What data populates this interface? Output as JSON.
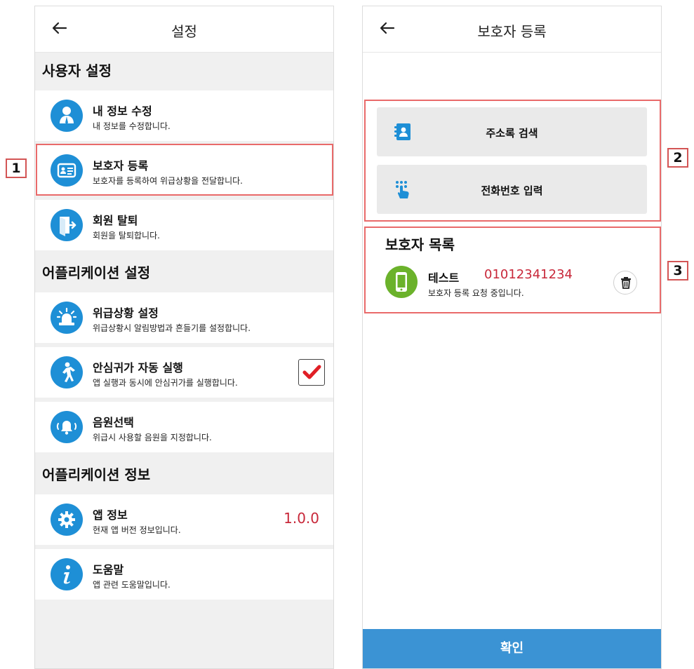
{
  "left": {
    "appbar": {
      "back_icon": "arrow-left-icon",
      "title": "설정"
    },
    "sections": {
      "user": "사용자 설정",
      "app_settings": "어플리케이션 설정",
      "app_info": "어플리케이션 정보"
    },
    "items": {
      "edit_profile": {
        "title": "내 정보 수정",
        "desc": "내 정보를 수정합니다.",
        "icon": "person-icon"
      },
      "guardian": {
        "title": "보호자 등록",
        "desc": "보호자를 등록하여 위급상황을 전달합니다.",
        "icon": "id-card-icon"
      },
      "withdraw": {
        "title": "회원 탈퇴",
        "desc": "회원을 탈퇴합니다.",
        "icon": "exit-door-icon"
      },
      "emergency": {
        "title": "위급상황 설정",
        "desc": "위급상황시 알림방법과 흔들기를 설정합니다.",
        "icon": "siren-icon"
      },
      "autorun": {
        "title": "안심귀가 자동 실행",
        "desc": "앱 실행과 동시에 안심귀가를 실행합니다.",
        "icon": "walking-person-icon",
        "checked": true
      },
      "sound": {
        "title": "음원선택",
        "desc": "위급시 사용할 음원을 지정합니다.",
        "icon": "bell-icon"
      },
      "app_version": {
        "title": "앱 정보",
        "desc": "현재 앱 버전 정보입니다.",
        "icon": "gear-icon",
        "value": "1.0.0"
      },
      "help": {
        "title": "도움말",
        "desc": "앱 관련 도움말입니다.",
        "icon": "info-icon"
      }
    }
  },
  "right": {
    "appbar": {
      "back_icon": "arrow-left-icon",
      "title": "보호자 등록"
    },
    "buttons": {
      "contacts": {
        "label": "주소록 검색",
        "icon": "contacts-book-icon"
      },
      "phone_input": {
        "label": "전화번호 입력",
        "icon": "keypad-touch-icon"
      }
    },
    "list_title": "보호자 목록",
    "guardian": {
      "name": "테스트",
      "phone": "01012341234",
      "status": "보호자 등록 요청 중입니다.",
      "icon": "smartphone-icon"
    },
    "confirm_label": "확인"
  },
  "markers": [
    "1",
    "2",
    "3"
  ],
  "colors": {
    "accent": "#1e8fd6",
    "value_red": "#c8283a",
    "confirm": "#3b93d4",
    "callout": "#e96a6a",
    "guardian_icon": "#6bb22b"
  }
}
